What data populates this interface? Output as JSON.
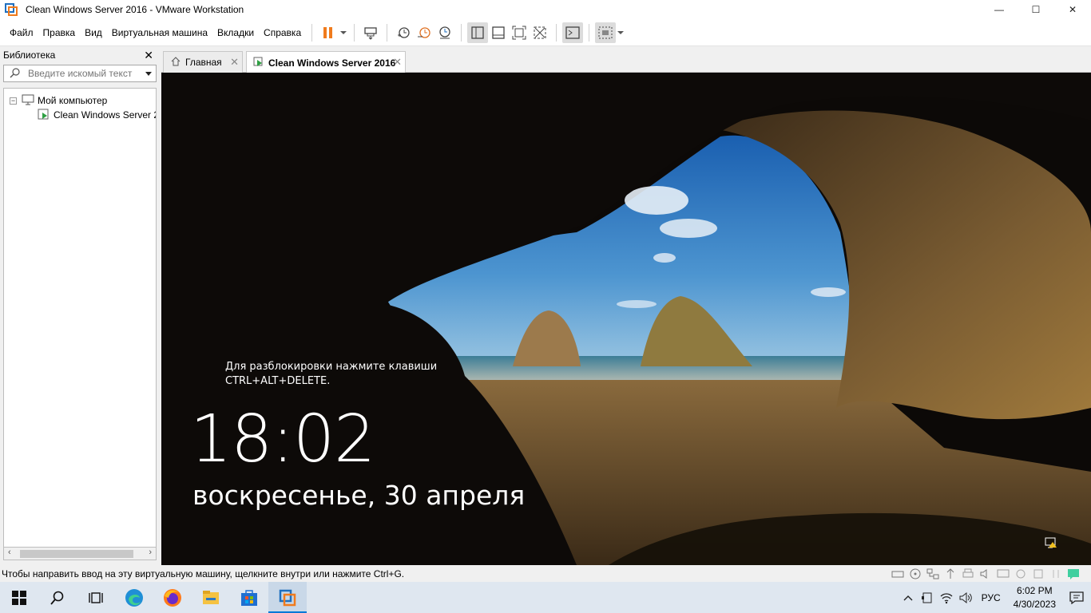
{
  "window": {
    "title": "Clean Windows Server 2016 - VMware Workstation",
    "minimize": "—",
    "maximize": "☐",
    "close": "✕"
  },
  "menu": [
    "Файл",
    "Правка",
    "Вид",
    "Виртуальная машина",
    "Вкладки",
    "Справка"
  ],
  "toolbar_icons": [
    "pause-icon",
    "send-ctrl-alt-del-icon",
    "snapshot-icon",
    "revert-snapshot-icon",
    "snapshot-manager-icon",
    "show-library-icon",
    "thumbnail-bar-icon",
    "full-screen-icon",
    "unity-icon",
    "console-view-icon",
    "stretch-guest-icon"
  ],
  "library": {
    "title": "Библиотека",
    "close": "✕",
    "search_placeholder": "Введите искомый текст",
    "root_label": "Мой компьютер",
    "root_expander": "−",
    "vm_label": "Clean Windows Server 2",
    "scroll_left": "‹",
    "scroll_right": "›"
  },
  "tabs": [
    {
      "label": "Главная",
      "close": "✕"
    },
    {
      "label": "Clean Windows Server 2016",
      "close": "✕"
    }
  ],
  "guest": {
    "hint_line1": "Для разблокировки нажмите клавиши",
    "hint_line2": "CTRL+ALT+DELETE.",
    "time": "18:02",
    "date": "воскресенье, 30 апреля"
  },
  "status": {
    "text": "Чтобы направить ввод на эту виртуальную машину, щелкните внутри или нажмите Ctrl+G."
  },
  "taskbar": {
    "apps": [
      "start-icon",
      "search-icon",
      "task-view-icon",
      "edge-icon",
      "firefox-icon",
      "file-explorer-icon",
      "store-icon",
      "vmware-icon"
    ],
    "language": "РУС",
    "time": "6:02 PM",
    "date": "4/30/2023"
  },
  "colors": {
    "accent": "#0078d7",
    "pause": "#f07b1d",
    "taskbar": "#dfe7f0"
  }
}
